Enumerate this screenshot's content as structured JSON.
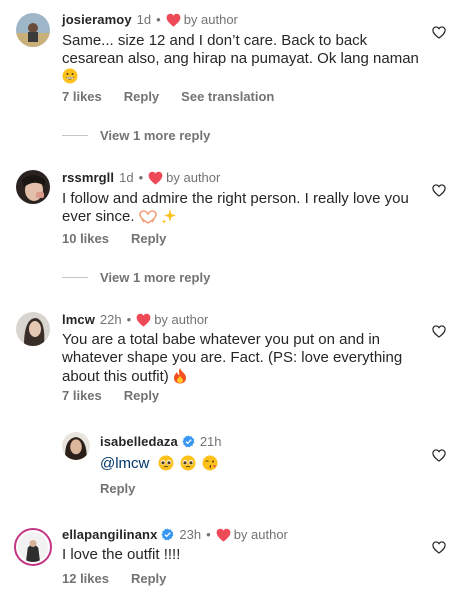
{
  "comments": [
    {
      "username": "josieramoy",
      "time": "1d",
      "dot": "•",
      "by_author": "by author",
      "text_line1": "Same... size 12 and I don’t care. Back to back",
      "text_line2": "cesarean also, ang hirap na pumayat. Ok lang naman",
      "emoji": "grinning-face",
      "likes": "7 likes",
      "reply": "Reply",
      "see_translation": "See translation"
    },
    {
      "username": "rssmrgll",
      "time": "1d",
      "dot": "•",
      "by_author": "by author",
      "text_line1": "I follow and admire the right person. I really love you",
      "text_line2": "ever since.",
      "emoji": "heart-hands sparkles",
      "likes": "10 likes",
      "reply": "Reply"
    },
    {
      "username": "lmcw",
      "time": "22h",
      "dot": "•",
      "by_author": "by author",
      "text_line1": "You are a total babe whatever you put on and in",
      "text_line2": "whatever shape you are. Fact. (PS: love everything",
      "text_line3": "about this outfit)",
      "emoji": "fire",
      "likes": "7 likes",
      "reply": "Reply"
    },
    {
      "username": "isabelledaza",
      "time": "21h",
      "text": "@lmcw",
      "emoji": "pleading pleading kissing",
      "reply": "Reply",
      "verified": true
    },
    {
      "username": "ellapangilinanx",
      "time": "23h",
      "dot": "•",
      "by_author": "by author",
      "text": "I love the outfit !!!!",
      "likes": "12 likes",
      "reply": "Reply",
      "verified": true
    }
  ],
  "view_more_1": "View 1 more reply",
  "view_more_2": "View 1 more reply",
  "colors": {
    "heart": "#ed4956",
    "muted": "#737373",
    "verified": "#3897f0",
    "story_ring": "#c13584"
  }
}
